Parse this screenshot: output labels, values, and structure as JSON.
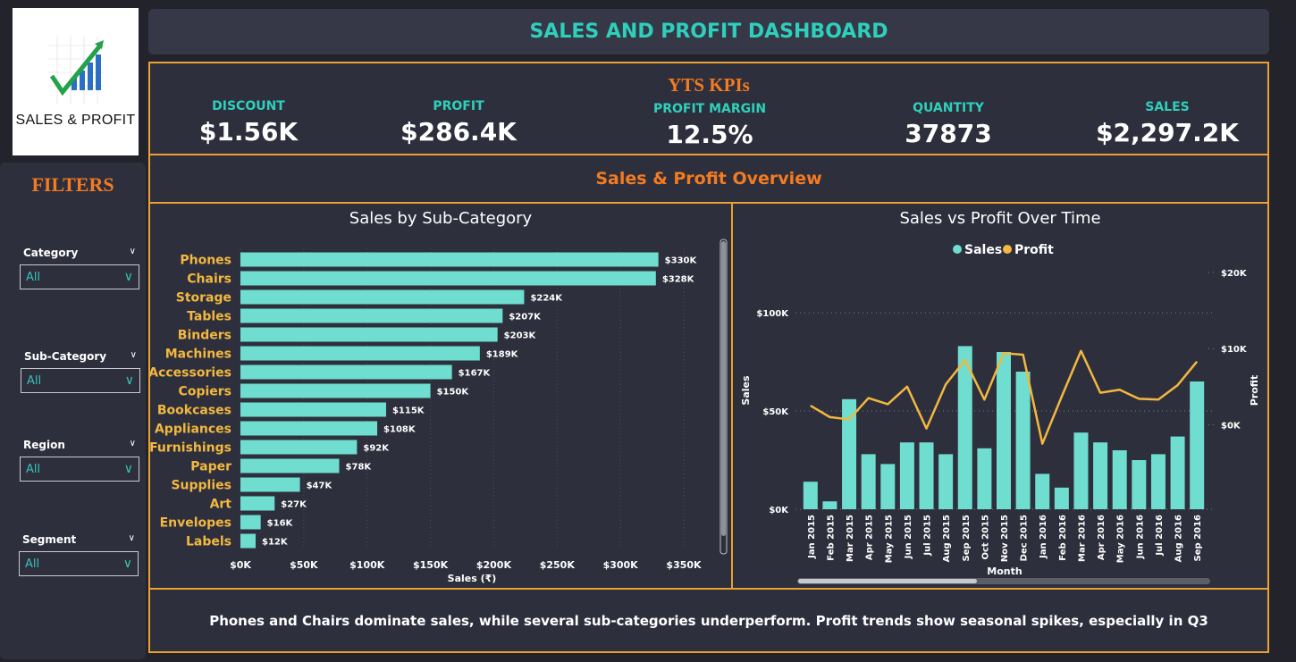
{
  "logo": {
    "text": "SALES & PROFIT"
  },
  "filters": {
    "title": "FILTERS",
    "items": [
      {
        "label": "Category",
        "value": "All"
      },
      {
        "label": "Sub-Category",
        "value": "All"
      },
      {
        "label": "Region",
        "value": "All"
      },
      {
        "label": "Segment",
        "value": "All"
      }
    ]
  },
  "header": {
    "title": "SALES AND PROFIT DASHBOARD"
  },
  "kpis": {
    "title": "YTS KPIs",
    "items": [
      {
        "label": "DISCOUNT",
        "value": "$1.56K"
      },
      {
        "label": "PROFIT",
        "value": "$286.4K"
      },
      {
        "label": "PROFIT MARGIN",
        "value": "12.5%"
      },
      {
        "label": "QUANTITY",
        "value": "37873"
      },
      {
        "label": "SALES",
        "value": "$2,297.2K"
      }
    ]
  },
  "overview": {
    "title": "Sales & Profit Overview"
  },
  "footer": {
    "text": "Phones and Chairs dominate sales, while several sub-categories underperform. Profit trends show seasonal spikes, especially in Q3"
  },
  "colors": {
    "accent_orange": "#f47b20",
    "frame": "#e9a232",
    "teal": "#6fddcf",
    "profit_line": "#f2b83f",
    "category_label": "#f2b83f",
    "header_text": "#2ed0bc"
  },
  "chart_data": [
    {
      "type": "bar",
      "orientation": "horizontal",
      "title": "Sales by Sub-Category",
      "xlabel": "Sales (₹)",
      "ylabel": "",
      "xlim": [
        0,
        350000
      ],
      "x_ticks": [
        "$0K",
        "$50K",
        "$100K",
        "$150K",
        "$200K",
        "$250K",
        "$300K",
        "$350K"
      ],
      "categories": [
        "Phones",
        "Chairs",
        "Storage",
        "Tables",
        "Binders",
        "Machines",
        "Accessories",
        "Copiers",
        "Bookcases",
        "Appliances",
        "Furnishings",
        "Paper",
        "Supplies",
        "Art",
        "Envelopes",
        "Labels"
      ],
      "values": [
        330000,
        328000,
        224000,
        207000,
        203000,
        189000,
        167000,
        150000,
        115000,
        108000,
        92000,
        78000,
        47000,
        27000,
        16000,
        12000
      ],
      "data_labels": [
        "$330K",
        "$328K",
        "$224K",
        "$207K",
        "$203K",
        "$189K",
        "$167K",
        "$150K",
        "$115K",
        "$108K",
        "$92K",
        "$78K",
        "$47K",
        "$27K",
        "$16K",
        "$12K"
      ],
      "grid": true
    },
    {
      "type": "bar+line",
      "title": "Sales vs Profit Over Time",
      "xlabel": "Month",
      "ylabel": "Sales",
      "y2label": "Profit",
      "legend": [
        "Sales",
        "Profit"
      ],
      "legend_position": "top-center",
      "ylim": [
        0,
        100000
      ],
      "y_ticks": [
        "$0K",
        "$50K",
        "$100K"
      ],
      "y2lim": [
        -5000,
        20000
      ],
      "y2_ticks": [
        "$0K",
        "$10K",
        "$20K"
      ],
      "categories": [
        "Jan 2015",
        "Feb 2015",
        "Mar 2015",
        "Apr 2015",
        "May 2015",
        "Jun 2015",
        "Jul 2015",
        "Aug 2015",
        "Sep 2015",
        "Oct 2015",
        "Nov 2015",
        "Dec 2015",
        "Jan 2016",
        "Feb 2016",
        "Mar 2016",
        "Apr 2016",
        "May 2016",
        "Jun 2016",
        "Jul 2016",
        "Aug 2016",
        "Sep 2016"
      ],
      "series": [
        {
          "name": "Sales",
          "values": [
            14000,
            4000,
            56000,
            28000,
            23000,
            34000,
            34000,
            28000,
            83000,
            31000,
            80000,
            70000,
            18000,
            11000,
            39000,
            34000,
            30000,
            25000,
            28000,
            37000,
            65000
          ]
        },
        {
          "name": "Profit",
          "values": [
            2500,
            1000,
            700,
            3500,
            2700,
            5000,
            -500,
            5300,
            8500,
            3300,
            9400,
            9200,
            -2500,
            3700,
            9700,
            4200,
            4600,
            3400,
            3300,
            5200,
            8300
          ]
        }
      ],
      "grid": true
    }
  ]
}
